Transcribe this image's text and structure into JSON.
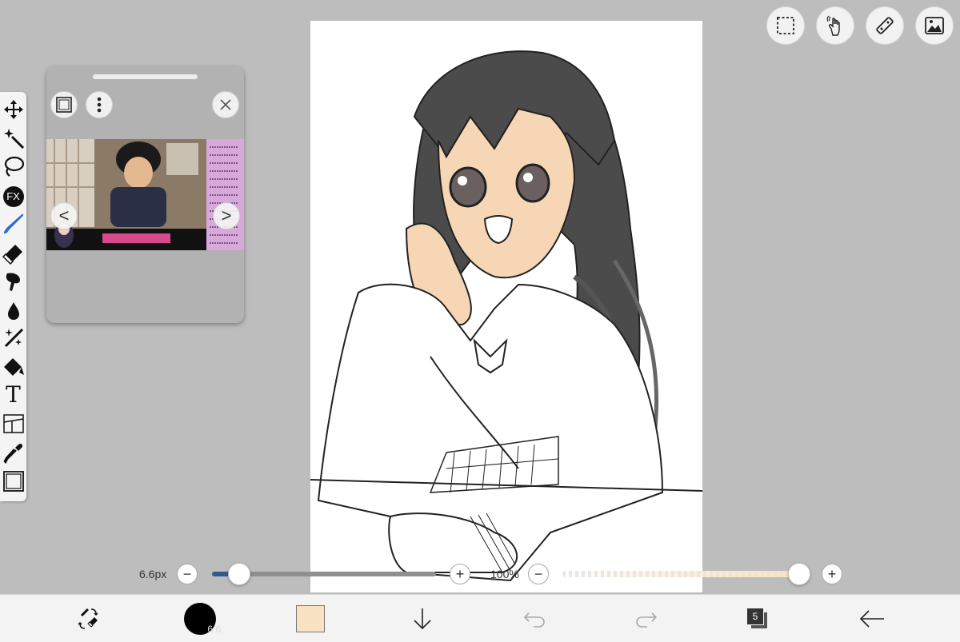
{
  "toolbar_top": {
    "buttons": [
      {
        "name": "selection-icon"
      },
      {
        "name": "hand-gesture-icon"
      },
      {
        "name": "ruler-icon"
      },
      {
        "name": "image-icon"
      }
    ]
  },
  "tools": [
    {
      "name": "move-icon"
    },
    {
      "name": "magic-wand-icon"
    },
    {
      "name": "lasso-icon"
    },
    {
      "name": "fx-icon",
      "label": "FX"
    },
    {
      "name": "brush-icon"
    },
    {
      "name": "eraser-icon"
    },
    {
      "name": "smudge-icon"
    },
    {
      "name": "fill-drop-icon"
    },
    {
      "name": "sparkle-brush-icon"
    },
    {
      "name": "shape-fill-icon"
    },
    {
      "name": "text-icon",
      "label": "T"
    },
    {
      "name": "frame-divider-icon"
    },
    {
      "name": "eyedropper-icon"
    },
    {
      "name": "canvas-icon"
    }
  ],
  "reference_panel": {
    "prev_label": "<",
    "next_label": ">"
  },
  "sliders": {
    "brush_size_label": "6.6px",
    "brush_size_fraction": 0.12,
    "opacity_label": "100%",
    "opacity_fraction": 1.0,
    "minus": "−",
    "plus": "+"
  },
  "bottom_bar": {
    "brush_size_badge": "6.6",
    "current_color": "#f8e2c2",
    "layer_count": "5"
  },
  "colors": {
    "accent": "#2e5b94",
    "background": "#bdbdbd",
    "hair": "#4b4b4b",
    "skin": "#f6d6b4"
  }
}
